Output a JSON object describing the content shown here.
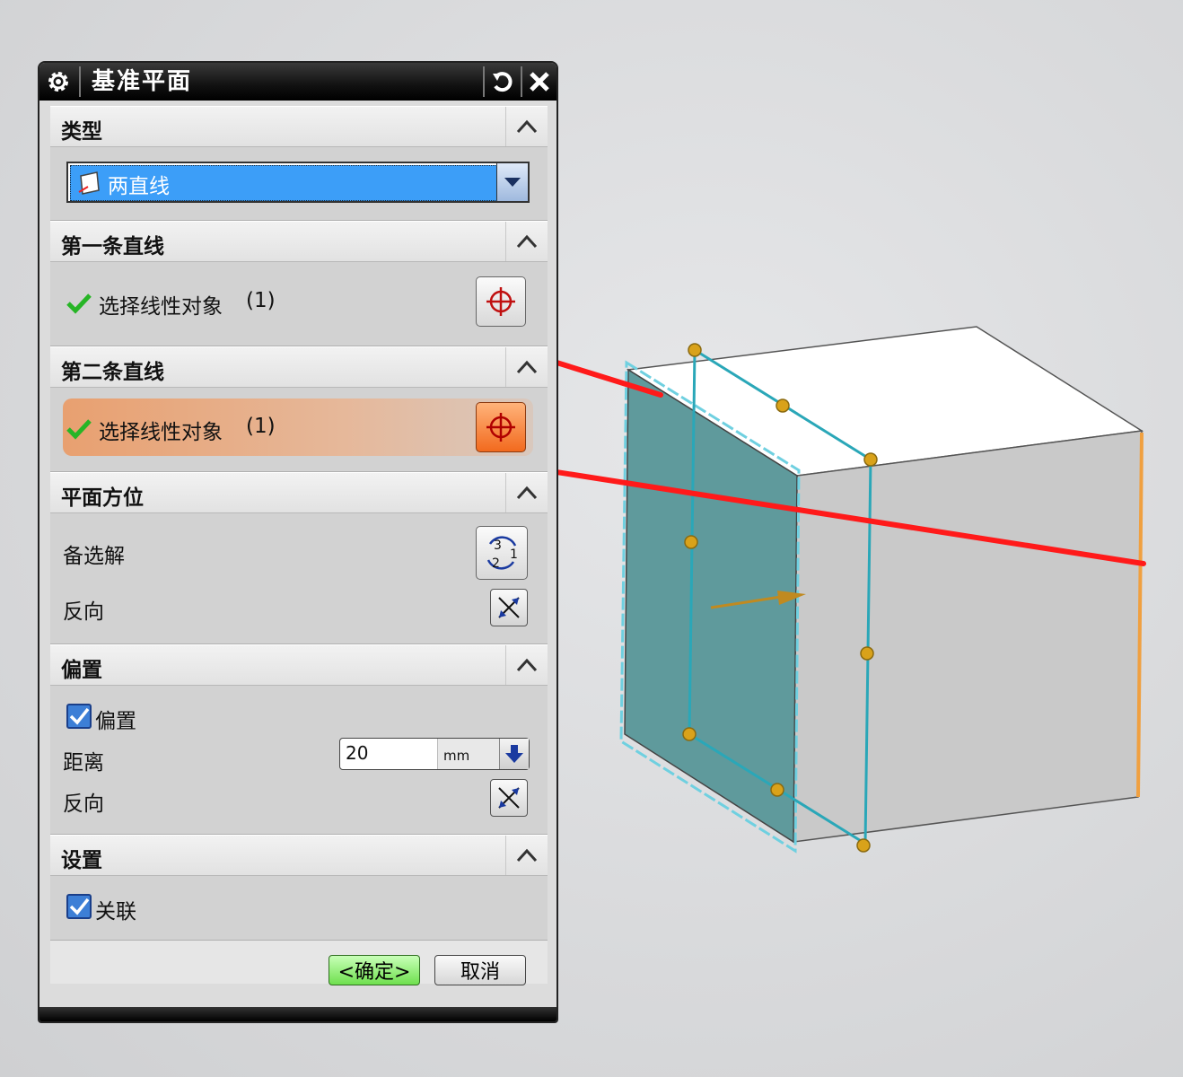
{
  "dialog": {
    "title": "基准平面",
    "sections": {
      "type": {
        "header": "类型",
        "selected": "两直线"
      },
      "first_line": {
        "header": "第一条直线",
        "select_label": "选择线性对象",
        "count": "(1)"
      },
      "second_line": {
        "header": "第二条直线",
        "select_label": "选择线性对象",
        "count": "(1)"
      },
      "orientation": {
        "header": "平面方位",
        "alternate_label": "备选解",
        "reverse_label": "反向"
      },
      "offset": {
        "header": "偏置",
        "checkbox_label": "偏置",
        "checked": true,
        "distance_label": "距离",
        "distance_value": "20",
        "unit": "mm",
        "reverse_label": "反向"
      },
      "settings": {
        "header": "设置",
        "checkbox_label": "关联",
        "checked": true
      }
    },
    "buttons": {
      "ok": "<确定>",
      "cancel": "取消"
    }
  },
  "colors": {
    "active_section": "#e8a070",
    "selection_line": "#ff1a1a",
    "plane_fill": "#5f9a9c",
    "plane_edge": "#2aa7b8",
    "handle": "#d9a21a"
  }
}
